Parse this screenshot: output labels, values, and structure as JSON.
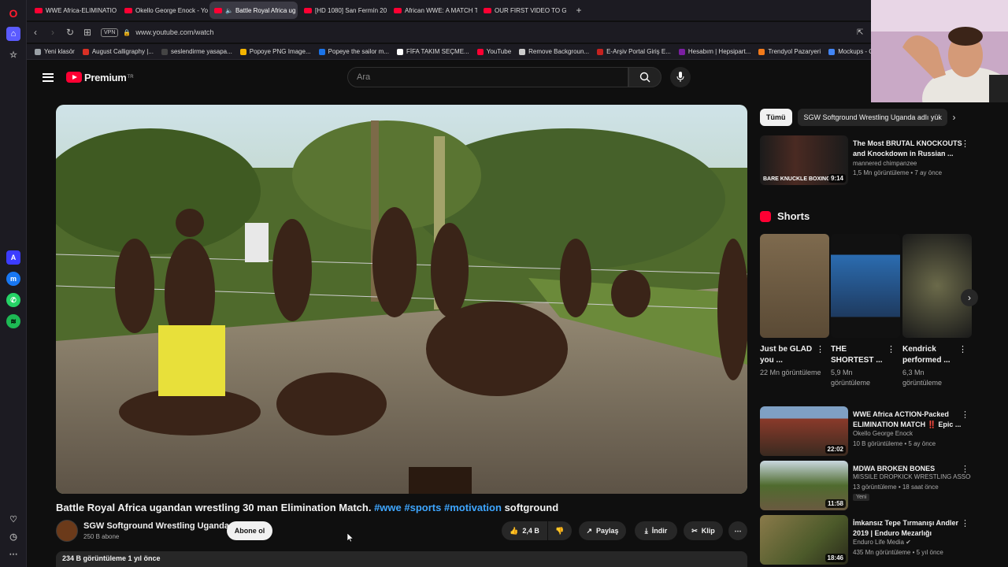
{
  "browser": {
    "tabs": [
      {
        "label": "WWE Africa-ELIMINATIO",
        "active": false
      },
      {
        "label": "Okello George Enock - Yo",
        "active": false
      },
      {
        "label": "Battle Royal Africa ug",
        "active": true
      },
      {
        "label": "[HD 1080] San Fermín 20",
        "active": false
      },
      {
        "label": "African WWE: A MATCH T",
        "active": false
      },
      {
        "label": "OUR FIRST VIDEO TO GO",
        "active": false
      }
    ],
    "new_tab": "+",
    "vpn_label": "VPN",
    "url": "www.youtube.com/watch",
    "bookmarks": [
      {
        "label": "Yeni klasör",
        "color": "#9aa0a6"
      },
      {
        "label": "August Calligraphy |...",
        "color": "#d93025"
      },
      {
        "label": "seslendirme yasapa...",
        "color": "#444444"
      },
      {
        "label": "Popoye PNG Image...",
        "color": "#f4b400"
      },
      {
        "label": "Popeye the sailor m...",
        "color": "#1a73e8"
      },
      {
        "label": "FİFA TAKIM SEÇME...",
        "color": "#ffffff"
      },
      {
        "label": "YouTube",
        "color": "#ff0033"
      },
      {
        "label": "Remove Backgroun...",
        "color": "#cccccc"
      },
      {
        "label": "E-Arşiv Portal Giriş E...",
        "color": "#c5221f"
      },
      {
        "label": "Hesabım | Hepsipart...",
        "color": "#7b1fa2"
      },
      {
        "label": "Trendyol Pazaryeri",
        "color": "#f27a1a"
      },
      {
        "label": "Mockups - Ca",
        "color": "#4285f4"
      }
    ]
  },
  "youtube": {
    "logo_text": "Premium",
    "logo_sup": "TR",
    "search_placeholder": "Ara"
  },
  "video": {
    "title": "Battle Royal Africa ugandan wrestling 30 man Elimination Match.",
    "hashtags": [
      "#wwe",
      "#sports",
      "#motivation"
    ],
    "title_suffix": "softground",
    "channel_name": "SGW Softground Wrestling Uganda",
    "subscribers": "250 B abone",
    "subscribe_label": "Abone ol",
    "likes": "2,4 B",
    "share_label": "Paylaş",
    "download_label": "İndir",
    "clip_label": "Klip",
    "views_line": "234 B görüntüleme  1 yıl önce"
  },
  "chips": [
    {
      "label": "Tümü",
      "active": true
    },
    {
      "label": "SGW Softground Wrestling Uganda adlı yük",
      "active": false
    }
  ],
  "recommendations_top": [
    {
      "title": "The Most BRUTAL KNOCKOUTS and Knockdown in Russian ...",
      "channel": "mannered chimpanzee",
      "meta": "1,5 Mn görüntüleme • 7 ay önce",
      "duration": "9:14"
    }
  ],
  "shorts_title": "Shorts",
  "shorts": [
    {
      "title": "Just be GLAD you ...",
      "views": "22 Mn görüntüleme"
    },
    {
      "title": "THE SHORTEST ...",
      "views": "5,9 Mn görüntüleme"
    },
    {
      "title": "Kendrick performed ...",
      "views": "6,3 Mn görüntüleme"
    }
  ],
  "recommendations": [
    {
      "title": "WWE Africa ACTION-Packed ELIMINATION MATCH ‼️ Epic ...",
      "channel": "Okello George Enock",
      "meta": "10 B görüntüleme • 5 ay önce",
      "duration": "22:02",
      "badge": ""
    },
    {
      "title": "MDWA BROKEN BONES",
      "channel": "MISSILE DROPKICK WRESTLING ASSOCI...",
      "meta": "13 görüntüleme • 18 saat önce",
      "duration": "11:58",
      "badge": "Yeni"
    },
    {
      "title": "İmkansız Tepe Tırmanışı Andler 2019 | Enduro Mezarlığı",
      "channel": "Enduro Life Media ✔",
      "meta": "435 Mn görüntüleme • 5 yıl önce",
      "duration": "18:46",
      "badge": ""
    }
  ]
}
